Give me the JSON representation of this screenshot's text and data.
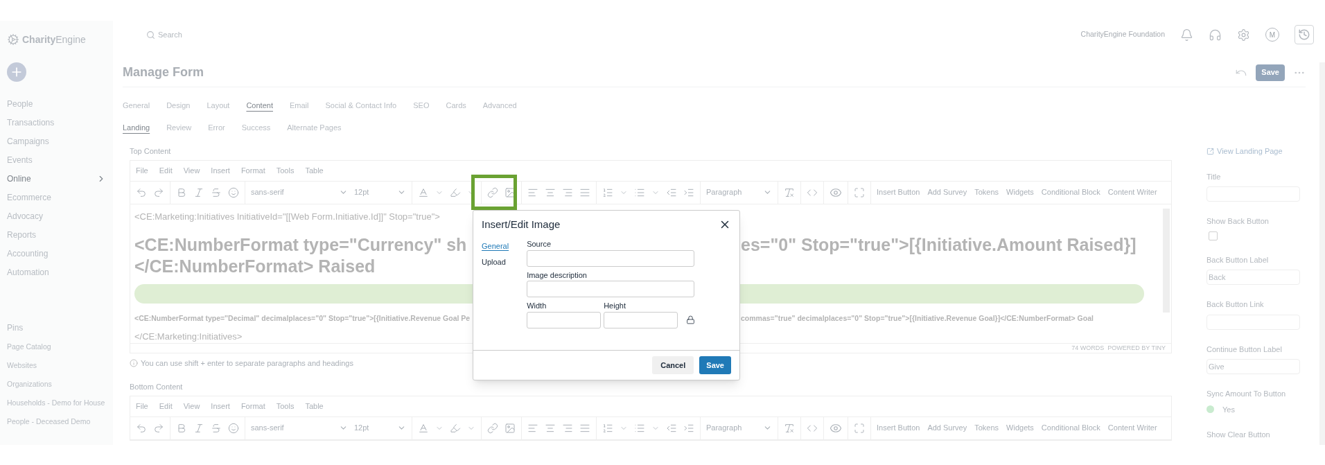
{
  "sidebar": {
    "logo": {
      "bold": "Charity",
      "light": "Engine"
    },
    "items": [
      {
        "label": "People",
        "selected": false
      },
      {
        "label": "Transactions",
        "selected": false
      },
      {
        "label": "Campaigns",
        "selected": false
      },
      {
        "label": "Events",
        "selected": false
      },
      {
        "label": "Online",
        "selected": true
      },
      {
        "label": "Ecommerce",
        "selected": false
      },
      {
        "label": "Advocacy",
        "selected": false
      },
      {
        "label": "Reports",
        "selected": false
      },
      {
        "label": "Accounting",
        "selected": false
      },
      {
        "label": "Automation",
        "selected": false
      }
    ],
    "pins_title": "Pins",
    "pins": [
      "Page Catalog",
      "Websites",
      "Organizations",
      "Households - Demo for House",
      "People - Deceased Demo"
    ]
  },
  "header": {
    "search_placeholder": "Search",
    "org": "CharityEngine Foundation",
    "avatar": "M"
  },
  "page": {
    "title": "Manage Form",
    "save": "Save"
  },
  "tabs": [
    {
      "label": "General",
      "selected": false
    },
    {
      "label": "Design",
      "selected": false
    },
    {
      "label": "Layout",
      "selected": false
    },
    {
      "label": "Content",
      "selected": true
    },
    {
      "label": "Email",
      "selected": false
    },
    {
      "label": "Social & Contact Info",
      "selected": false
    },
    {
      "label": "SEO",
      "selected": false
    },
    {
      "label": "Cards",
      "selected": false
    },
    {
      "label": "Advanced",
      "selected": false
    }
  ],
  "subtabs": [
    {
      "label": "Landing",
      "selected": true
    },
    {
      "label": "Review",
      "selected": false
    },
    {
      "label": "Error",
      "selected": false
    },
    {
      "label": "Success",
      "selected": false
    },
    {
      "label": "Alternate Pages",
      "selected": false
    }
  ],
  "editors": [
    {
      "label": "Top Content",
      "menu": [
        "File",
        "Edit",
        "View",
        "Insert",
        "Format",
        "Tools",
        "Table"
      ],
      "font": "sans-serif",
      "size": "12pt",
      "block": "Paragraph",
      "buttons": [
        "Insert Button",
        "Add Survey",
        "Tokens",
        "Widgets",
        "Conditional Block",
        "Content Writer"
      ],
      "content": [
        {
          "kind": "line",
          "parts": [
            "<CE:Marketing:Initiatives InitiativeId=\"[[Web Form.Initiative.Id]]\" Stop=\"true\">"
          ]
        },
        {
          "kind": "heading",
          "parts": [
            "<CE:NumberFormat type=\"Currency\" sh",
            "es=\"0\" Stop=\"true\">[{Initiative.Amount Raised}]"
          ]
        },
        {
          "kind": "heading",
          "parts": [
            "</CE:NumberFormat> Raised"
          ]
        },
        {
          "kind": "bar",
          "level": 0
        },
        {
          "kind": "note",
          "parts": [
            "<CE:NumberFormat type=\"Decimal\" decimalplaces=\"0\" Stop=\"true\">[{Initiative.Revenue Goal Pe",
            "commas=\"true\" decimalplaces=\"0\" Stop=\"true\">[{Initiative.Revenue Goal}]</CE:NumberFormat> Goal"
          ]
        },
        {
          "kind": "line",
          "parts": [
            "</CE:Marketing:Initiatives>"
          ]
        }
      ],
      "status": "74 WORDS  POWERED BY TINY",
      "hint": "You can use shift + enter to separate paragraphs and headings"
    },
    {
      "label": "Bottom Content",
      "menu": [
        "File",
        "Edit",
        "View",
        "Insert",
        "Format",
        "Tools",
        "Table"
      ],
      "font": "sans-serif",
      "size": "12pt",
      "block": "Paragraph",
      "buttons": [
        "Insert Button",
        "Add Survey",
        "Tokens",
        "Widgets",
        "Conditional Block",
        "Content Writer"
      ]
    }
  ],
  "right_panel": {
    "link": "View Landing Page",
    "fields": [
      {
        "kind": "input",
        "label": "Title"
      },
      {
        "kind": "checkbox",
        "label": "Show Back Button",
        "checked": false
      },
      {
        "kind": "input",
        "label": "Back Button Label",
        "value": "Back"
      },
      {
        "kind": "input",
        "label": "Back Button Link"
      },
      {
        "kind": "input",
        "label": "Continue Button Label",
        "value": "Give"
      },
      {
        "kind": "radio",
        "label": "Sync Amount To Button",
        "option": "Yes",
        "selected": true
      },
      {
        "kind": "heading",
        "label": "Show Clear Button"
      }
    ]
  },
  "dialog": {
    "title": "Insert/Edit Image",
    "tabs": [
      {
        "label": "General",
        "selected": true
      },
      {
        "label": "Upload",
        "selected": false
      }
    ],
    "source_label": "Source",
    "description_label": "Image description",
    "width_label": "Width",
    "height_label": "Height",
    "cancel": "Cancel",
    "save": "Save"
  }
}
